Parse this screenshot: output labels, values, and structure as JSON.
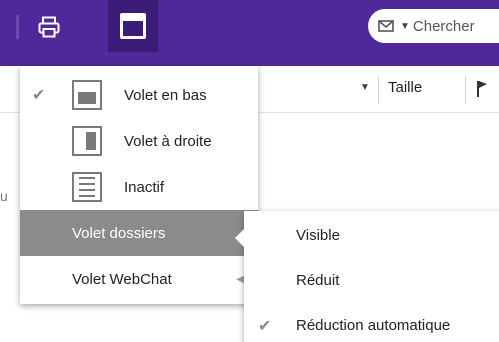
{
  "toolbar": {
    "search_placeholder": "Chercher"
  },
  "column_header": {
    "size_label": "Taille"
  },
  "edge_text": "u",
  "menu": {
    "items": [
      {
        "label": "Volet en bas",
        "checked": true,
        "icon": "reading-pane-bottom-icon"
      },
      {
        "label": "Volet à droite",
        "checked": false,
        "icon": "reading-pane-right-icon"
      },
      {
        "label": "Inactif",
        "checked": false,
        "icon": "reading-pane-off-icon"
      },
      {
        "label": "Volet dossiers",
        "has_submenu": true,
        "highlighted": true
      },
      {
        "label": "Volet WebChat",
        "has_submenu": true
      }
    ]
  },
  "submenu": {
    "items": [
      {
        "label": "Visible",
        "checked": false
      },
      {
        "label": "Réduit",
        "checked": false
      },
      {
        "label": "Réduction automatique",
        "checked": true
      }
    ]
  },
  "colors": {
    "toolbar": "#51289a",
    "toolbar_active": "#3a1b78",
    "highlight": "#8b8b8b"
  }
}
